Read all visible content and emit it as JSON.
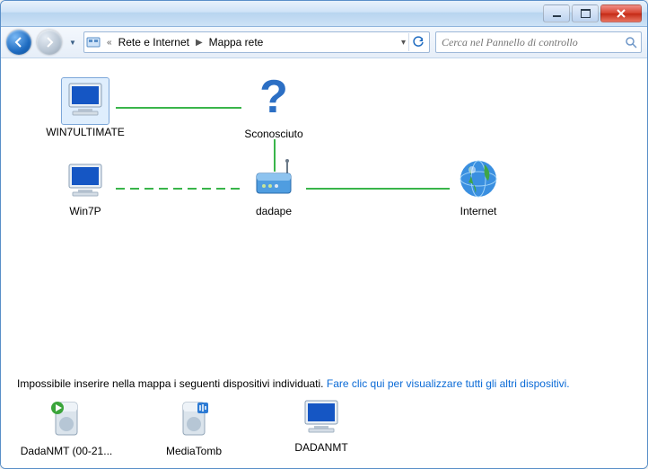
{
  "breadcrumb": {
    "prefix": "«",
    "part1": "Rete e Internet",
    "part2": "Mappa rete"
  },
  "search": {
    "placeholder": "Cerca nel Pannello di controllo"
  },
  "nodes": {
    "win7ultimate": "WIN7ULTIMATE",
    "sconosciuto": "Sconosciuto",
    "win7p": "Win7P",
    "dadape": "dadape",
    "internet": "Internet"
  },
  "footer": {
    "msg": "Impossibile inserire nella mappa i seguenti dispositivi individuati.",
    "link": "Fare clic qui per visualizzare tutti gli altri dispositivi."
  },
  "devices": {
    "dadanmt0021": "DadaNMT (00-21...",
    "mediatomb": "MediaTomb",
    "dadanmt": "DADANMT"
  }
}
